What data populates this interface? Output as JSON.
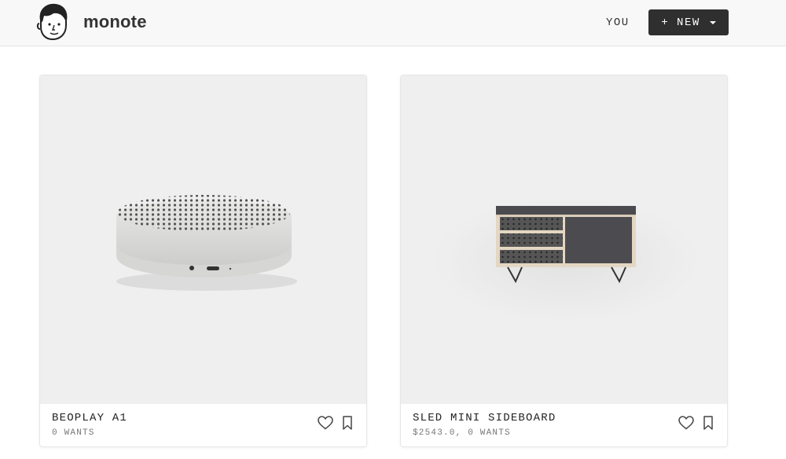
{
  "header": {
    "app_name": "monote",
    "you_label": "YOU",
    "new_label": "+ NEW"
  },
  "products": [
    {
      "title": "BEOPLAY A1",
      "meta": "0 WANTS"
    },
    {
      "title": "SLED MINI SIDEBOARD",
      "meta": "$2543.0, 0 WANTS"
    }
  ],
  "icons": {
    "avatar": "face-avatar-icon",
    "caret": "chevron-down-icon",
    "heart": "heart-icon",
    "bookmark": "bookmark-icon"
  },
  "colors": {
    "header_bg": "#f8f8f8",
    "button_bg": "#2f2f2f",
    "image_bg": "#efefef"
  }
}
